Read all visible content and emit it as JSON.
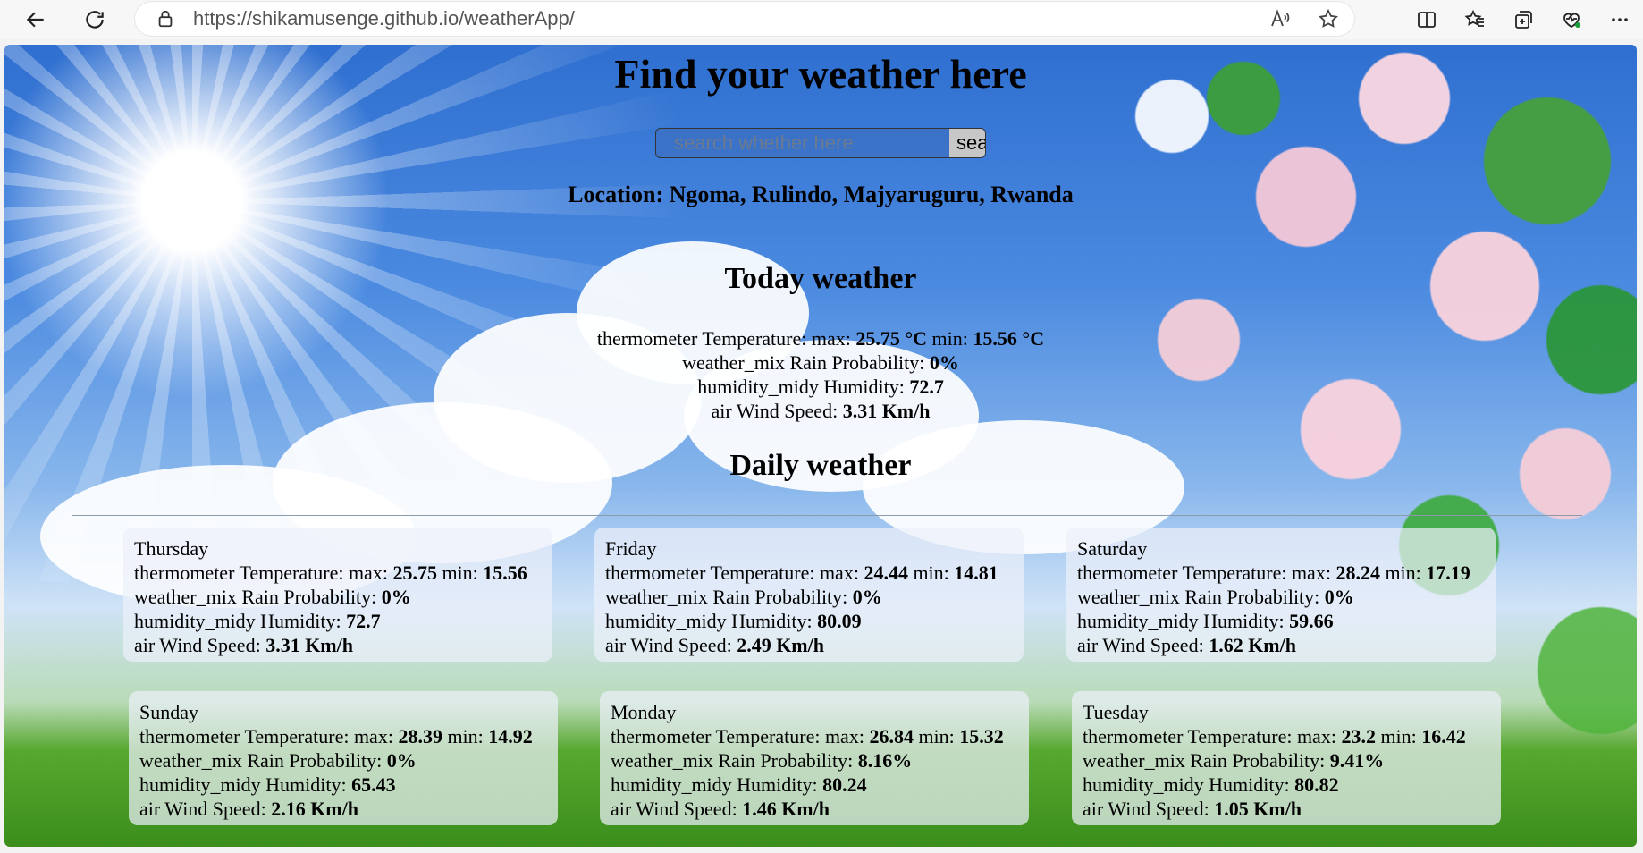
{
  "browser": {
    "url": "https://shikamusenge.github.io/weatherApp/",
    "icons": [
      "back-icon",
      "refresh-icon",
      "lock-icon",
      "read-aloud-icon",
      "favorite-star-icon",
      "split-screen-icon",
      "favorites-icon",
      "collections-icon",
      "browser-essentials-icon",
      "more-icon"
    ]
  },
  "page": {
    "title": "Find your weather here",
    "search_placeholder": "search whether here",
    "search_button": "sea",
    "location": "Location: Ngoma, Rulindo, Majyaruguru, Rwanda",
    "today_heading": "Today weather",
    "daily_heading": "Daily weather"
  },
  "today": {
    "temp_label": "thermometer Temperature: max:",
    "temp_max": "25.75 °C",
    "temp_min_label": "min:",
    "temp_min": "15.56 °C",
    "rain_label": "weather_mix Rain Probability:",
    "rain": "0%",
    "humidity_label": "humidity_midy Humidity:",
    "humidity": "72.7",
    "wind_label": "air Wind Speed:",
    "wind": "3.31 Km/h"
  },
  "days": [
    {
      "day": "Thursday",
      "max": "25.75",
      "min": "15.56",
      "rain": "0%",
      "humidity": "72.7",
      "wind": "3.31 Km/h"
    },
    {
      "day": "Friday",
      "max": "24.44",
      "min": "14.81",
      "rain": "0%",
      "humidity": "80.09",
      "wind": "2.49 Km/h"
    },
    {
      "day": "Saturday",
      "max": "28.24",
      "min": "17.19",
      "rain": "0%",
      "humidity": "59.66",
      "wind": "1.62 Km/h"
    },
    {
      "day": "Sunday",
      "max": "28.39",
      "min": "14.92",
      "rain": "0%",
      "humidity": "65.43",
      "wind": "2.16 Km/h"
    },
    {
      "day": "Monday",
      "max": "26.84",
      "min": "15.32",
      "rain": "8.16%",
      "humidity": "80.24",
      "wind": "1.46 Km/h"
    },
    {
      "day": "Tuesday",
      "max": "23.2",
      "min": "16.42",
      "rain": "9.41%",
      "humidity": "80.82",
      "wind": "1.05 Km/h"
    }
  ],
  "labels": {
    "temp": "thermometer Temperature: max:",
    "min": "min:",
    "rain": "weather_mix Rain Probability:",
    "humidity": "humidity_midy Humidity:",
    "wind": "air Wind Speed:"
  }
}
